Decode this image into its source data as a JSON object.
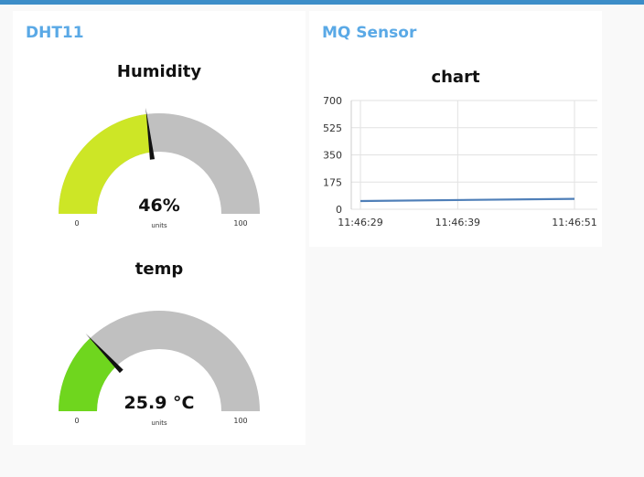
{
  "colors": {
    "top_bar": "#3c8dc8",
    "group_title": "#5aa9e6",
    "gauge_track": "#c0c0c0",
    "humidity_fill": "#cde626",
    "temp_fill": "#6fd61e",
    "needle": "#111111",
    "line": "#4f7fb8"
  },
  "groups": [
    {
      "title": "DHT11",
      "gauges": [
        {
          "title": "Humidity",
          "value": 46,
          "display": "46%",
          "units": "units",
          "min": "0",
          "max": "100",
          "min_value": 0,
          "max_value": 100
        },
        {
          "title": "temp",
          "value": 25.9,
          "display": "25.9 °C",
          "units": "units",
          "min": "0",
          "max": "100",
          "min_value": 0,
          "max_value": 100
        }
      ]
    },
    {
      "title": "MQ Sensor",
      "chart_title": "chart"
    }
  ],
  "chart_data": {
    "type": "line",
    "title": "chart",
    "x": [
      "11:46:29",
      "11:46:51"
    ],
    "x_seconds": [
      0,
      22
    ],
    "series": [
      {
        "values": [
          53,
          67
        ]
      }
    ],
    "xticks": [
      "11:46:29",
      "11:46:39",
      "11:46:51"
    ],
    "xtick_seconds": [
      0,
      10,
      22
    ],
    "yticks": [
      "700",
      "525",
      "350",
      "175",
      "0"
    ],
    "ylim": [
      0,
      700
    ],
    "grid": true
  }
}
